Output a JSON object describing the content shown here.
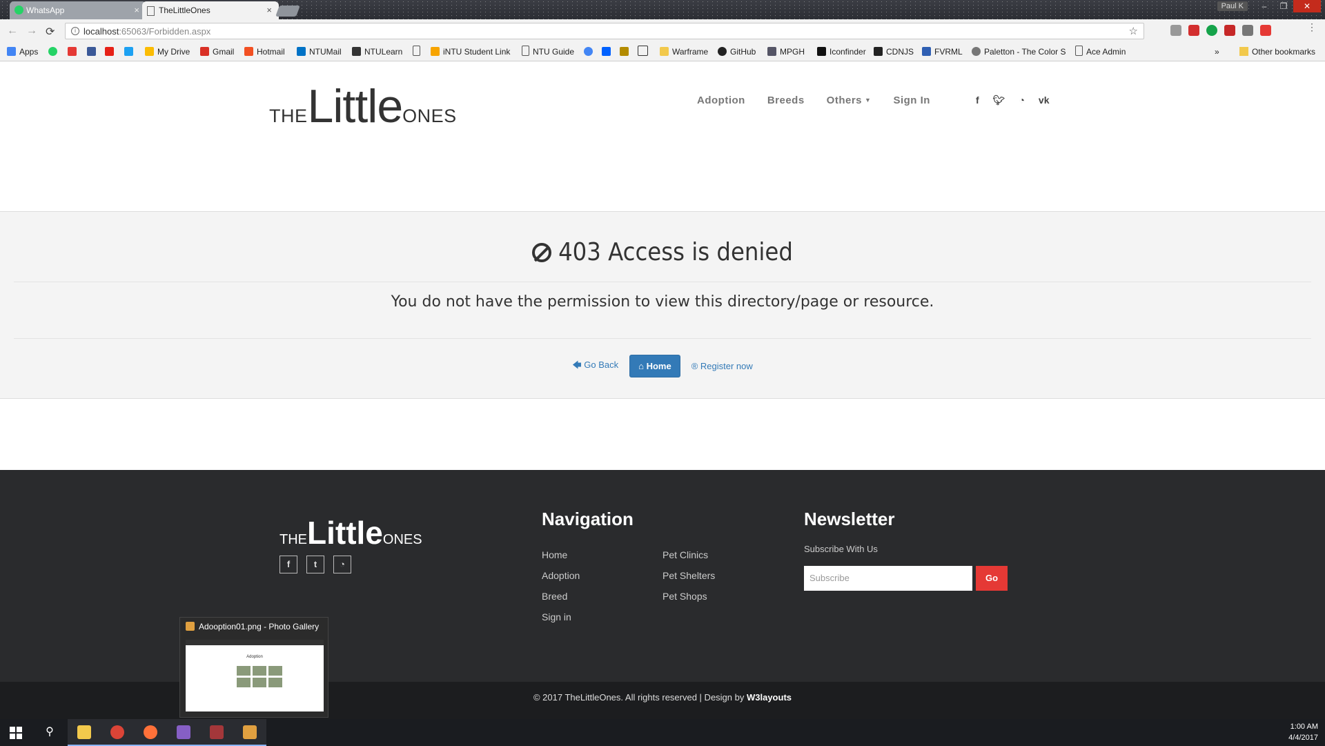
{
  "browser": {
    "tabs": [
      {
        "title": "WhatsApp",
        "active": false
      },
      {
        "title": "TheLittleOnes",
        "active": true
      }
    ],
    "user": "Paul K",
    "url_host": "localhost",
    "url_rest": ":65063/Forbidden.aspx",
    "bookmarks": [
      "Apps",
      "My Drive",
      "Gmail",
      "Hotmail",
      "NTUMail",
      "NTULearn",
      "iNTU Student Link",
      "NTU Guide",
      "Warframe",
      "GitHub",
      "MPGH",
      "Iconfinder",
      "CDNJS",
      "FVRML",
      "Paletton - The Color S",
      "Ace Admin"
    ],
    "other_bookmarks": "Other bookmarks",
    "overflow": "»"
  },
  "site": {
    "logo": {
      "the": "THE",
      "little": "Little",
      "ones": "ONES"
    },
    "nav": [
      "Adoption",
      "Breeds",
      "Others",
      "Sign In"
    ],
    "social_icons": [
      "facebook-icon",
      "twitter-icon",
      "rss-icon",
      "vk-icon"
    ]
  },
  "error": {
    "title": "403 Access is denied",
    "message": "You do not have the permission to view this directory/page or resource.",
    "go_back": "Go Back",
    "home": "Home",
    "register": "Register now"
  },
  "footer": {
    "navigation_title": "Navigation",
    "nav_col1": [
      "Home",
      "Adoption",
      "Breed",
      "Sign in"
    ],
    "nav_col2": [
      "Pet Clinics",
      "Pet Shelters",
      "Pet Shops"
    ],
    "newsletter_title": "Newsletter",
    "subscribe_label": "Subscribe With Us",
    "subscribe_placeholder": "Subscribe",
    "go": "Go",
    "copyright": "© 2017 TheLittleOnes. All rights reserved | Design by ",
    "designer": "W3layouts"
  },
  "thumbnail": {
    "title": "Adooption01.png - Photo Gallery",
    "preview_heading": "Adoption"
  },
  "taskbar": {
    "time": "1:00 AM",
    "date": "4/4/2017"
  }
}
